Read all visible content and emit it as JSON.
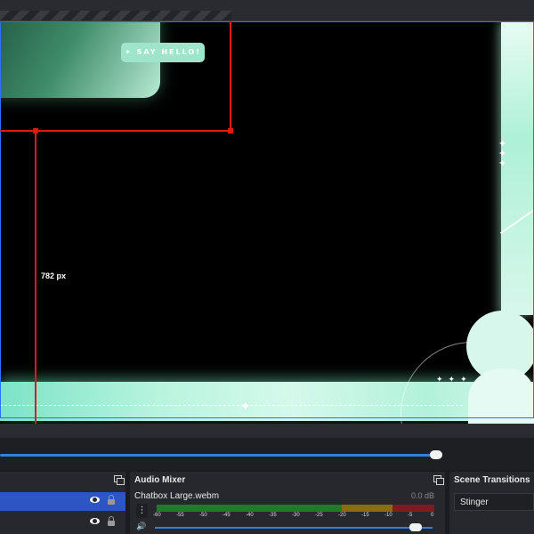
{
  "preview": {
    "overlay_button_label": "✦ SAY HELLO!",
    "measure_label": "782 px"
  },
  "docks": {
    "audio_mixer": {
      "title": "Audio Mixer",
      "source_name": "Chatbox Large.webm",
      "level_db": "0.0 dB",
      "meter_ticks": [
        "-60",
        "-55",
        "-50",
        "-45",
        "-40",
        "-35",
        "-30",
        "-25",
        "-20",
        "-15",
        "-10",
        "-5",
        "0"
      ],
      "volume_fraction": 0.96
    },
    "scene_transitions": {
      "title": "Scene Transitions",
      "selected_transition": "Stinger"
    },
    "sources": {
      "rows": [
        {
          "selected": true,
          "visible": true,
          "locked": true
        },
        {
          "selected": false,
          "visible": true,
          "locked": true
        }
      ]
    }
  },
  "playback": {
    "progress_fraction": 0.825
  },
  "colors": {
    "selection_blue": "#2c56c4",
    "guide_red": "#e01818",
    "accent_teal": "#9ee5cc"
  },
  "icons": [
    "eye-icon",
    "lock-icon",
    "float-dock-icon",
    "kebab-menu-icon",
    "speaker-icon",
    "sparkle-icon"
  ]
}
